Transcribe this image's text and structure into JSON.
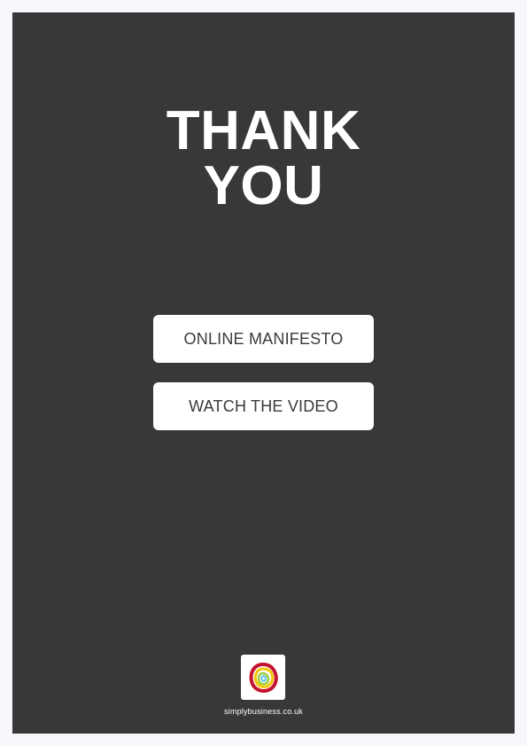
{
  "title": {
    "line1": "THANK",
    "line2": "YOU"
  },
  "buttons": {
    "manifesto_label": "ONLINE MANIFESTO",
    "video_label": "WATCH THE VIDEO"
  },
  "footer": {
    "logo_icon": "simply-business-logo-icon",
    "website": "simplybusiness.co.uk"
  },
  "colors": {
    "page_background": "#f7f8fb",
    "panel_background": "#393738",
    "button_background": "#ffffff",
    "button_text": "#3a3a3a"
  }
}
